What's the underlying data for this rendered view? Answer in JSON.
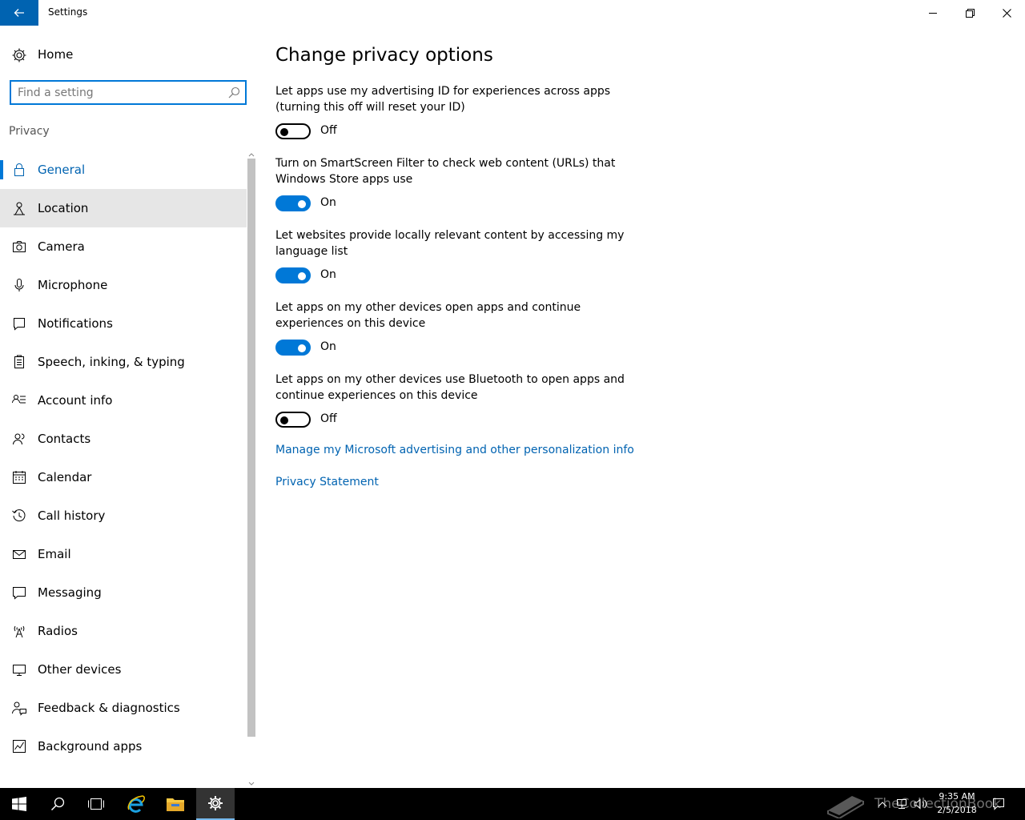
{
  "window": {
    "title": "Settings",
    "back_icon": "back-arrow-icon",
    "controls": [
      "minimize-icon",
      "restore-icon",
      "close-icon"
    ]
  },
  "nav": {
    "home_label": "Home",
    "search_placeholder": "Find a setting",
    "search_value": "",
    "section_label": "Privacy",
    "items": [
      {
        "label": "General",
        "icon": "lock-icon",
        "state": "active"
      },
      {
        "label": "Location",
        "icon": "location-icon",
        "state": "hover"
      },
      {
        "label": "Camera",
        "icon": "camera-icon"
      },
      {
        "label": "Microphone",
        "icon": "microphone-icon"
      },
      {
        "label": "Notifications",
        "icon": "notifications-icon"
      },
      {
        "label": "Speech, inking, & typing",
        "icon": "speech-clipboard-icon"
      },
      {
        "label": "Account info",
        "icon": "account-info-icon"
      },
      {
        "label": "Contacts",
        "icon": "contacts-icon"
      },
      {
        "label": "Calendar",
        "icon": "calendar-icon"
      },
      {
        "label": "Call history",
        "icon": "call-history-icon"
      },
      {
        "label": "Email",
        "icon": "email-icon"
      },
      {
        "label": "Messaging",
        "icon": "messaging-icon"
      },
      {
        "label": "Radios",
        "icon": "radios-icon"
      },
      {
        "label": "Other devices",
        "icon": "other-devices-icon"
      },
      {
        "label": "Feedback & diagnostics",
        "icon": "feedback-icon"
      },
      {
        "label": "Background apps",
        "icon": "background-apps-icon"
      }
    ]
  },
  "main": {
    "heading": "Change privacy options",
    "options": [
      {
        "text": "Let apps use my advertising ID for experiences across apps (turning this off will reset your ID)",
        "state_label": "Off",
        "on": false
      },
      {
        "text": "Turn on SmartScreen Filter to check web content (URLs) that Windows Store apps use",
        "state_label": "On",
        "on": true
      },
      {
        "text": "Let websites provide locally relevant content by accessing my language list",
        "state_label": "On",
        "on": true
      },
      {
        "text": "Let apps on my other devices open apps and continue experiences on this device",
        "state_label": "On",
        "on": true
      },
      {
        "text": "Let apps on my other devices use Bluetooth to open apps and continue experiences on this device",
        "state_label": "Off",
        "on": false
      }
    ],
    "links": {
      "manage_advertising": "Manage my Microsoft advertising and other personalization info",
      "privacy_statement": "Privacy Statement"
    }
  },
  "taskbar": {
    "time": "9:35 AM",
    "date": "2/5/2018",
    "watermark": "TheCollectionBook",
    "accent_color": "#0078d7"
  }
}
